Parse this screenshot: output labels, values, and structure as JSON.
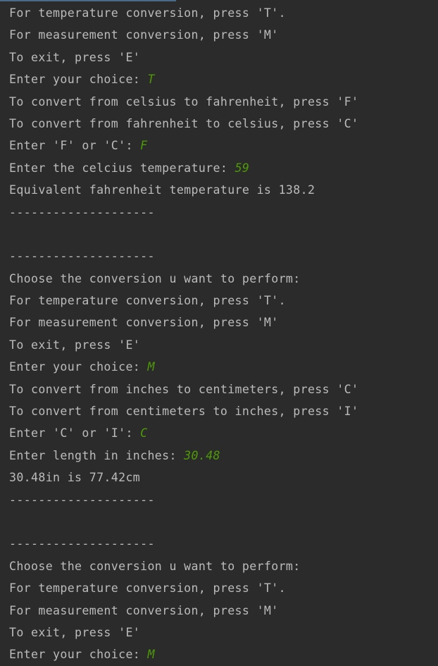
{
  "console": {
    "lines": [
      {
        "text": "For temperature conversion, press 'T'.",
        "input": ""
      },
      {
        "text": "For measurement conversion, press 'M'",
        "input": ""
      },
      {
        "text": "To exit, press 'E'",
        "input": ""
      },
      {
        "text": "Enter your choice: ",
        "input": "T"
      },
      {
        "text": "To convert from celsius to fahrenheit, press 'F'",
        "input": ""
      },
      {
        "text": "To convert from fahrenheit to celsius, press 'C'",
        "input": ""
      },
      {
        "text": "Enter 'F' or 'C': ",
        "input": "F"
      },
      {
        "text": "Enter the celcius temperature: ",
        "input": "59"
      },
      {
        "text": "Equivalent fahrenheit temperature is 138.2",
        "input": ""
      },
      {
        "text": "--------------------",
        "input": ""
      },
      {
        "text": "",
        "input": ""
      },
      {
        "text": "--------------------",
        "input": ""
      },
      {
        "text": "Choose the conversion u want to perform:",
        "input": ""
      },
      {
        "text": "For temperature conversion, press 'T'.",
        "input": ""
      },
      {
        "text": "For measurement conversion, press 'M'",
        "input": ""
      },
      {
        "text": "To exit, press 'E'",
        "input": ""
      },
      {
        "text": "Enter your choice: ",
        "input": "M"
      },
      {
        "text": "To convert from inches to centimeters, press 'C'",
        "input": ""
      },
      {
        "text": "To convert from centimeters to inches, press 'I'",
        "input": ""
      },
      {
        "text": "Enter 'C' or 'I': ",
        "input": "C"
      },
      {
        "text": "Enter length in inches: ",
        "input": "30.48"
      },
      {
        "text": "30.48in is 77.42cm",
        "input": ""
      },
      {
        "text": "--------------------",
        "input": ""
      },
      {
        "text": "",
        "input": ""
      },
      {
        "text": "--------------------",
        "input": ""
      },
      {
        "text": "Choose the conversion u want to perform:",
        "input": ""
      },
      {
        "text": "For temperature conversion, press 'T'.",
        "input": ""
      },
      {
        "text": "For measurement conversion, press 'M'",
        "input": ""
      },
      {
        "text": "To exit, press 'E'",
        "input": ""
      },
      {
        "text": "Enter your choice: ",
        "input": "M"
      }
    ]
  },
  "colors": {
    "background": "#2b2b2b",
    "output_text": "#bbbbbb",
    "user_input": "#4e9a06"
  }
}
